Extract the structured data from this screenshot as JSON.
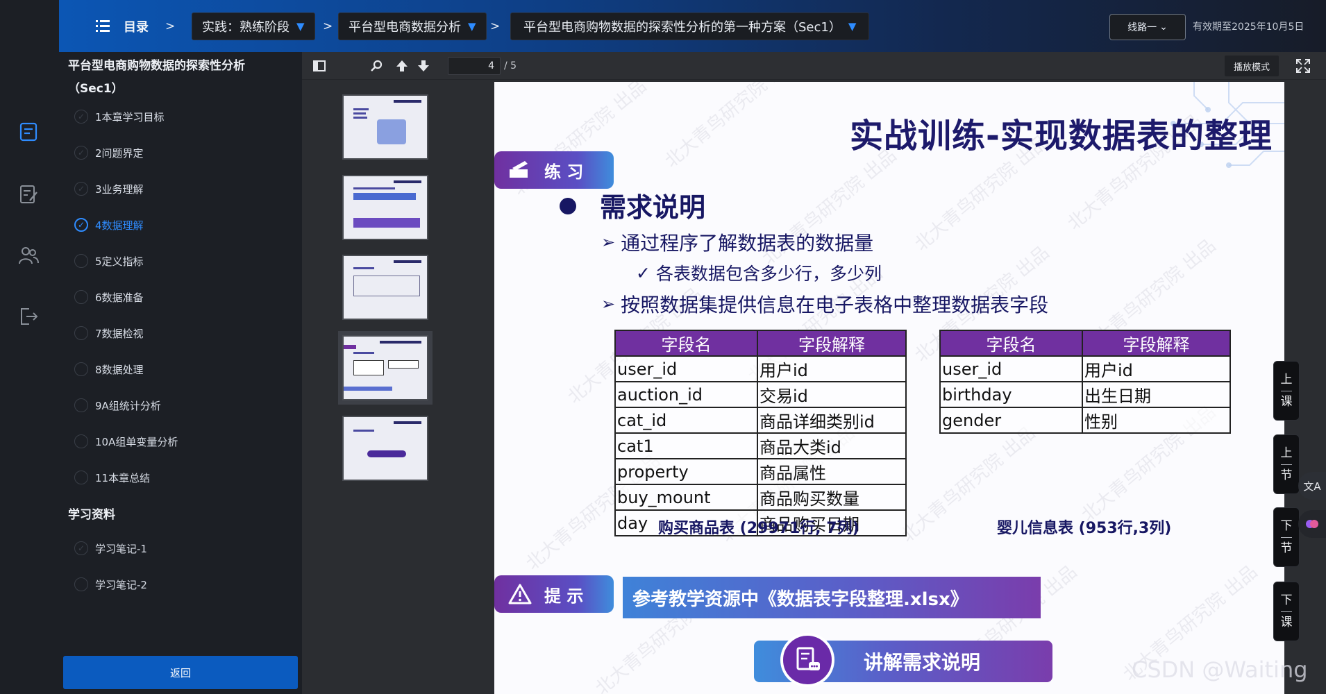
{
  "topbar": {
    "menu_label": "目录",
    "crumb_sep": ">",
    "crumbs": [
      {
        "label": "实践：熟练阶段",
        "caret": "▼"
      },
      {
        "label": "平台型电商数据分析",
        "caret": "▼"
      },
      {
        "label": "平台型电商购物数据的探索性分析的第一种方案（Sec1）",
        "caret": "▼"
      }
    ],
    "route_label": "线路一",
    "route_caret": "⌄",
    "expiry": "有效期至2025年10月5日"
  },
  "sidebar": {
    "course_title": "平台型电商购物数据的探索性分析（Sec1）",
    "chapters": [
      {
        "label": "1本章学习目标",
        "active": false
      },
      {
        "label": "2问题界定",
        "active": false
      },
      {
        "label": "3业务理解",
        "active": false
      },
      {
        "label": "4数据理解",
        "active": true
      },
      {
        "label": "5定义指标",
        "active": false
      },
      {
        "label": "6数据准备",
        "active": false
      },
      {
        "label": "7数据检视",
        "active": false
      },
      {
        "label": "8数据处理",
        "active": false
      },
      {
        "label": "9A组统计分析",
        "active": false
      },
      {
        "label": "10A组单变量分析",
        "active": false
      },
      {
        "label": "11本章总结",
        "active": false
      }
    ],
    "materials_title": "学习资料",
    "materials": [
      {
        "label": "学习笔记-1"
      },
      {
        "label": "学习笔记-2"
      }
    ],
    "back_label": "返回"
  },
  "viewer": {
    "current_page": "4",
    "total_pages": "/ 5",
    "play_mode": "播放模式"
  },
  "slide": {
    "title": "实战训练-实现数据表的整理",
    "practice_tag": "练 习",
    "req_title": "需求说明",
    "point1": "通过程序了解数据表的数据量",
    "point1_sub": "各表数据包含多少行，多少列",
    "point2": "按照数据集提供信息在电子表格中整理数据表字段",
    "arrow": "➢",
    "check": "✓",
    "table_headers": [
      "字段名",
      "字段解释"
    ],
    "table1_rows": [
      [
        "user_id",
        "用户id"
      ],
      [
        "auction_id",
        "交易id"
      ],
      [
        "cat_id",
        "商品详细类别id"
      ],
      [
        "cat1",
        "商品大类id"
      ],
      [
        "property",
        "商品属性"
      ],
      [
        "buy_mount",
        "商品购买数量"
      ],
      [
        "day",
        "商品购买日期"
      ]
    ],
    "table1_caption": "购买商品表 (29971行, 7列)",
    "table2_rows": [
      [
        "user_id",
        "用户id"
      ],
      [
        "birthday",
        "出生日期"
      ],
      [
        "gender",
        "性别"
      ]
    ],
    "table2_caption": "婴儿信息表 (953行,3列)",
    "hint_tag": "提 示",
    "hint_text": "参考教学资源中《数据表字段整理.xlsx》",
    "explain_button": "讲解需求说明",
    "watermark": "北大青鸟研究院 出品"
  },
  "side_nav": [
    {
      "top": "上",
      "bottom": "课"
    },
    {
      "top": "上",
      "bottom": "节"
    },
    {
      "top": "下",
      "bottom": "节"
    },
    {
      "top": "下",
      "bottom": "课"
    }
  ],
  "float_translate": "文A",
  "csdn_watermark": "CSDN @Waiting",
  "colors": {
    "accent_blue": "#2f8cff",
    "header_purple": "#7030a0",
    "slide_navy": "#171763"
  }
}
